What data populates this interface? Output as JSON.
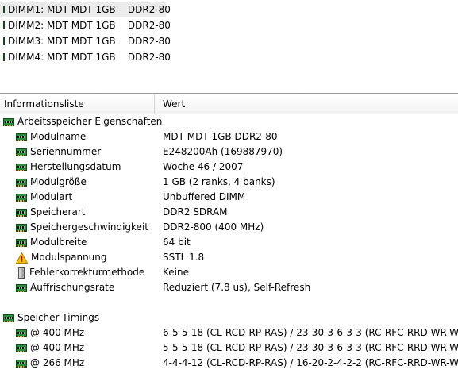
{
  "dimms": [
    {
      "label": "DIMM1: MDT MDT 1GB    DDR2-80",
      "selected": true
    },
    {
      "label": "DIMM2: MDT MDT 1GB    DDR2-80",
      "selected": false
    },
    {
      "label": "DIMM3: MDT MDT 1GB    DDR2-80",
      "selected": false
    },
    {
      "label": "DIMM4: MDT MDT 1GB    DDR2-80",
      "selected": false
    }
  ],
  "columns": {
    "field": "Informationsliste",
    "value": "Wert"
  },
  "section_memory": {
    "title": "Arbeitsspeicher Eigenschaften",
    "icon": "ram-module-icon"
  },
  "properties": [
    {
      "label": "Modulname",
      "value": "MDT MDT 1GB    DDR2-80",
      "icon": "ram-module-icon"
    },
    {
      "label": "Seriennummer",
      "value": "E248200Ah (169887970)",
      "icon": "ram-module-icon"
    },
    {
      "label": "Herstellungsdatum",
      "value": "Woche 46 / 2007",
      "icon": "ram-module-icon"
    },
    {
      "label": "Modulgröße",
      "value": "1 GB (2 ranks, 4 banks)",
      "icon": "ram-module-icon"
    },
    {
      "label": "Modulart",
      "value": "Unbuffered DIMM",
      "icon": "ram-module-icon"
    },
    {
      "label": "Speicherart",
      "value": "DDR2 SDRAM",
      "icon": "ram-module-icon"
    },
    {
      "label": "Speichergeschwindigkeit",
      "value": "DDR2-800 (400 MHz)",
      "icon": "ram-module-icon"
    },
    {
      "label": "Modulbreite",
      "value": "64 bit",
      "icon": "ram-module-icon"
    },
    {
      "label": "Modulspannung",
      "value": "SSTL 1.8",
      "icon": "warning-icon"
    },
    {
      "label": "Fehlerkorrekturmethode",
      "value": "Keine",
      "icon": "chip-icon"
    },
    {
      "label": "Auffrischungsrate",
      "value": "Reduziert (7.8 us), Self-Refresh",
      "icon": "ram-module-icon"
    }
  ],
  "section_timings": {
    "title": "Speicher Timings",
    "icon": "ram-module-icon"
  },
  "timings": [
    {
      "label": "@ 400 MHz",
      "value": "6-5-5-18  (CL-RCD-RP-RAS) / 23-30-3-6-3-3  (RC-RFC-RRD-WR-W..."
    },
    {
      "label": "@ 400 MHz",
      "value": "5-5-5-18  (CL-RCD-RP-RAS) / 23-30-3-6-3-3  (RC-RFC-RRD-WR-W..."
    },
    {
      "label": "@ 266 MHz",
      "value": "4-4-4-12  (CL-RCD-RP-RAS) / 16-20-2-4-2-2  (RC-RFC-RRD-WR-W..."
    }
  ]
}
